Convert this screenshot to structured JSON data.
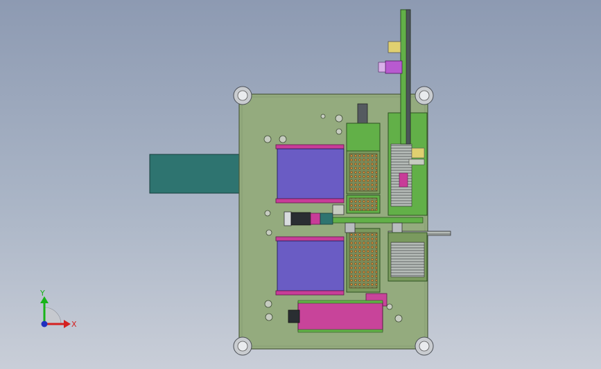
{
  "triad": {
    "y_label": "Y",
    "x_label": "X",
    "y_color": "#18b418",
    "x_color": "#d42020",
    "z_color": "#2030c0"
  },
  "colors": {
    "plate": "#94ab7e",
    "plate_edge": "#4a5a3c",
    "tray": "#6a5cc4",
    "tray_rim": "#c83c98",
    "pcb": "#62b048",
    "motor_teal": "#2e7470",
    "magenta_block": "#c8449a",
    "violet_cap": "#b85ad0",
    "orange_grid": "#d08a3a"
  }
}
